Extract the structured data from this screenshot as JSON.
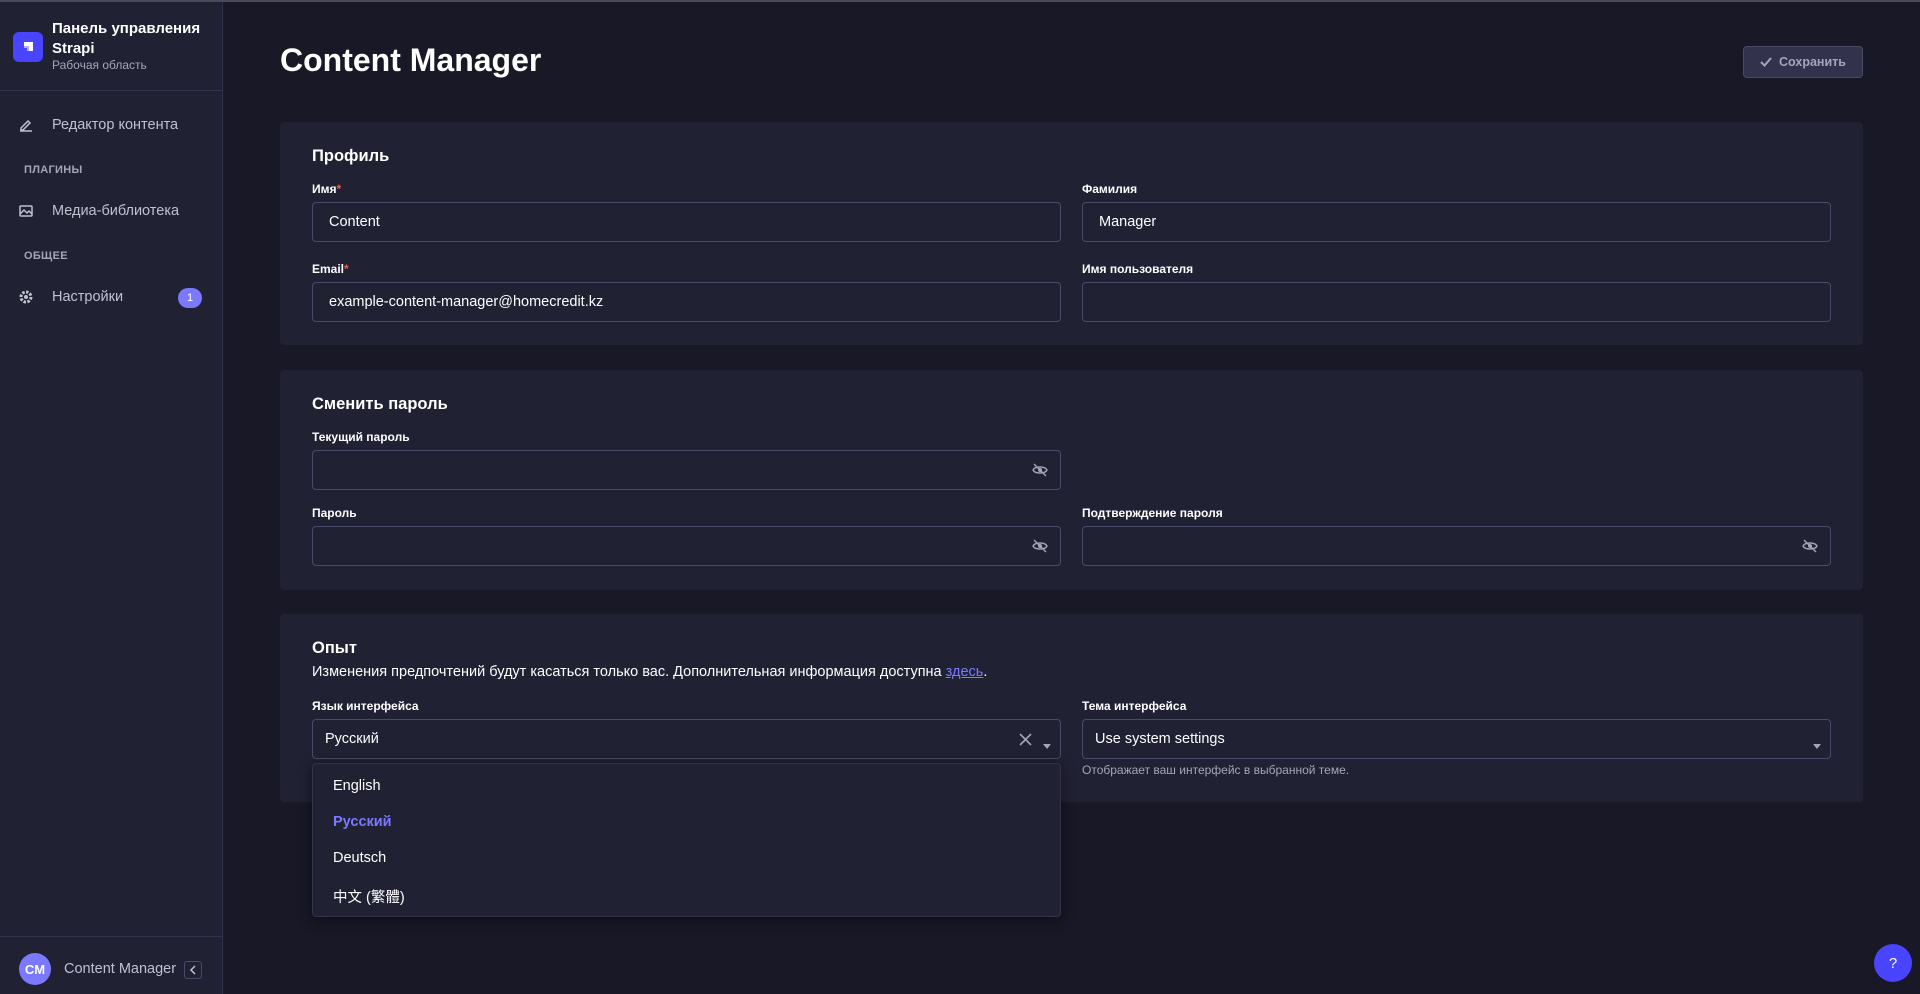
{
  "app": {
    "brand_title": "Панель управления Strapi",
    "brand_subtitle": "Рабочая область"
  },
  "sidebar": {
    "items": [
      {
        "label": "Редактор контента",
        "icon": "pencil-icon"
      },
      {
        "label": "Медиа-библиотека",
        "icon": "image-icon"
      },
      {
        "label": "Настройки",
        "icon": "gear-icon",
        "badge": "1"
      }
    ],
    "sections": [
      "ПЛАГИНЫ",
      "ОБЩЕЕ"
    ],
    "user": {
      "initials": "CM",
      "name": "Content Manager"
    }
  },
  "header": {
    "title": "Content Manager",
    "save_label": "Сохранить"
  },
  "profile": {
    "title": "Профиль",
    "first_name_label": "Имя",
    "first_name_value": "Content",
    "last_name_label": "Фамилия",
    "last_name_value": "Manager",
    "email_label": "Email",
    "email_value": "example-content-manager@homecredit.kz",
    "username_label": "Имя пользователя",
    "username_value": "",
    "required_mark": "*"
  },
  "password": {
    "title": "Сменить пароль",
    "current_label": "Текущий пароль",
    "new_label": "Пароль",
    "confirm_label": "Подтверждение пароля"
  },
  "experience": {
    "title": "Опыт",
    "description": "Изменения предпочтений будут касаться только вас. Дополнительная информация доступна ",
    "link": "здесь",
    "period": ".",
    "language_label": "Язык интерфейса",
    "language_value": "Русский",
    "theme_label": "Тема интерфейса",
    "theme_value": "Use system settings",
    "theme_hint": "Отображает ваш интерфейс в выбранной теме.",
    "language_options": [
      "English",
      "Русский",
      "Deutsch",
      "中文 (繁體)"
    ],
    "selected_option": "Русский"
  },
  "help": {
    "label": "?"
  },
  "colors": {
    "background": "#181826",
    "sidebar": "#212134",
    "accent": "#4945ff",
    "accent_light": "#7b79ff",
    "required": "#ee5e52"
  }
}
